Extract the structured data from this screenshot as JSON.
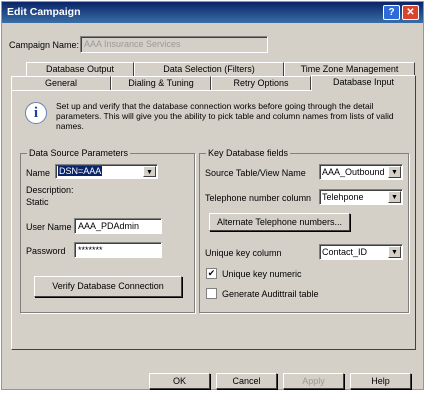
{
  "window": {
    "title": "Edit Campaign",
    "help_icon": "?",
    "close_icon": "✕"
  },
  "campaign": {
    "label": "Campaign Name:",
    "value": "AAA Insurance Services"
  },
  "tabs_row1": [
    "Database Output",
    "Data Selection (Filters)",
    "Time Zone Management"
  ],
  "tabs_row2": [
    "General",
    "Dialing & Tuning",
    "Retry Options",
    "Database Input"
  ],
  "info": {
    "icon": "i",
    "text": "Set up and verify that the database connection works before going through the detail parameters. This will give you the ability to pick table and column names from lists of valid names."
  },
  "datasource": {
    "legend": "Data Source Parameters",
    "name_label": "Name",
    "name_value": "DSN=AAA",
    "description_label": "Description:",
    "description_value": "Static",
    "username_label": "User Name",
    "username_value": "AAA_PDAdmin",
    "password_label": "Password",
    "password_value": "*******",
    "verify_button": "Verify Database Connection"
  },
  "keyfields": {
    "legend": "Key Database fields",
    "source_label": "Source Table/View Name",
    "source_value": "AAA_Outbound",
    "phone_label": "Telephone number column",
    "phone_value": "Telehpone",
    "alt_button": "Alternate Telephone numbers...",
    "unique_label": "Unique key column",
    "unique_value": "Contact_ID",
    "numeric_label": "Unique key numeric",
    "numeric_checked": "✔",
    "audit_label": "Generate Audittrail table"
  },
  "footer": {
    "ok": "OK",
    "cancel": "Cancel",
    "apply": "Apply",
    "help": "Help"
  },
  "arrow_icon": "▼"
}
